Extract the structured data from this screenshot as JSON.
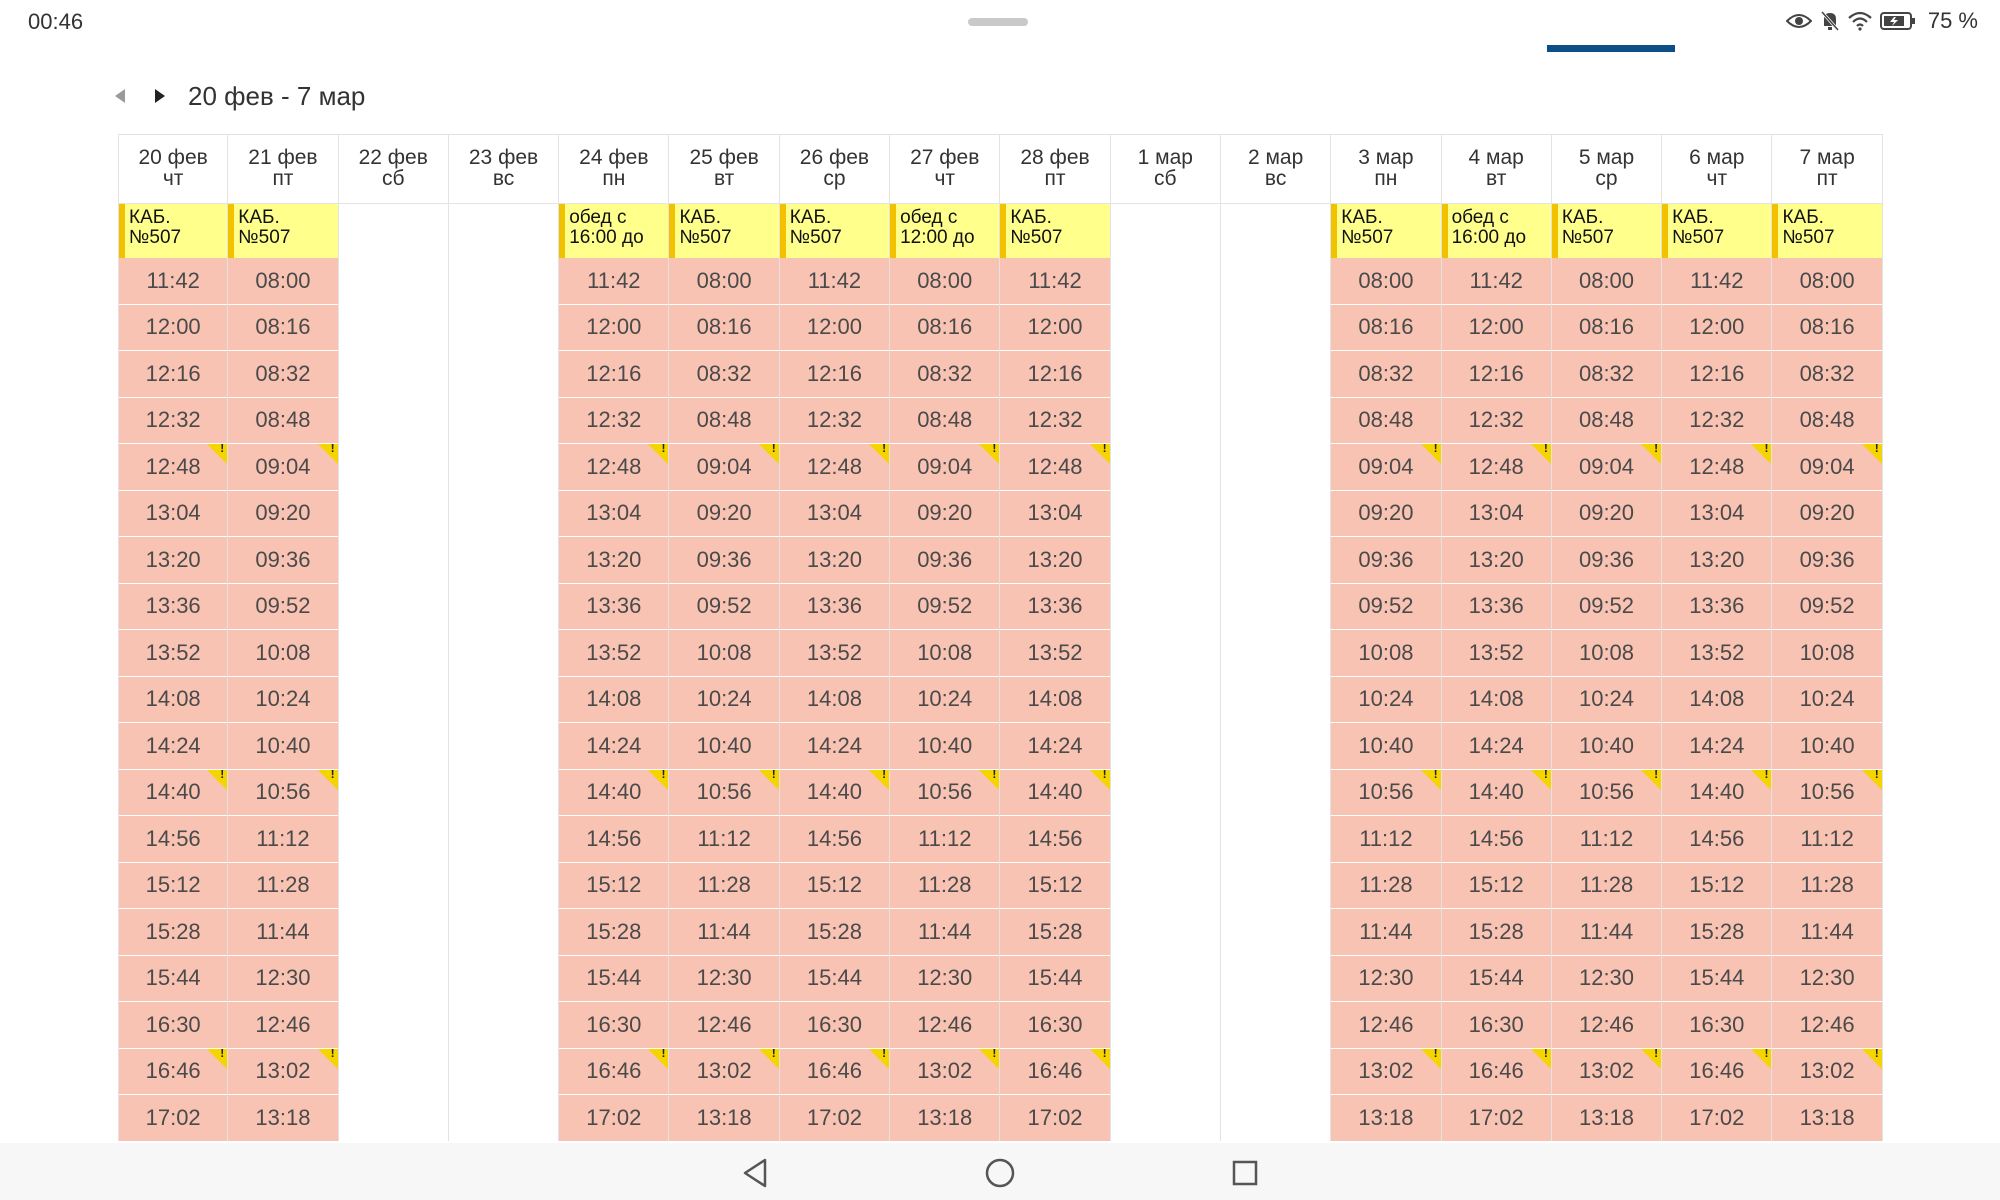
{
  "status_bar": {
    "time": "00:46",
    "battery_text": "75 %",
    "icons": [
      "eye-icon",
      "mute-bell-icon",
      "wifi-icon",
      "battery-icon"
    ]
  },
  "navigation": {
    "prev_icon": "triangle-left-icon",
    "next_icon": "triangle-right-icon",
    "range_label": "20 фев - 7 мар"
  },
  "colors": {
    "slot_bg": "#f8c3b3",
    "note_bg": "#ffff8c",
    "note_accent": "#f2c200",
    "warn_flag": "#f5d400",
    "tab_indicator": "#0b4f86"
  },
  "days": [
    {
      "date": "20 фев",
      "weekday": "чт",
      "note": [
        "КАБ.",
        "№507"
      ],
      "warn": [
        4,
        11,
        17
      ],
      "slots": [
        "11:42",
        "12:00",
        "12:16",
        "12:32",
        "12:48",
        "13:04",
        "13:20",
        "13:36",
        "13:52",
        "14:08",
        "14:24",
        "14:40",
        "14:56",
        "15:12",
        "15:28",
        "15:44",
        "16:30",
        "16:46",
        "17:02"
      ]
    },
    {
      "date": "21 фев",
      "weekday": "пт",
      "note": [
        "КАБ.",
        "№507"
      ],
      "warn": [
        4,
        11,
        17
      ],
      "slots": [
        "08:00",
        "08:16",
        "08:32",
        "08:48",
        "09:04",
        "09:20",
        "09:36",
        "09:52",
        "10:08",
        "10:24",
        "10:40",
        "10:56",
        "11:12",
        "11:28",
        "11:44",
        "12:30",
        "12:46",
        "13:02",
        "13:18"
      ]
    },
    {
      "date": "22 фев",
      "weekday": "сб",
      "note": [],
      "warn": [],
      "slots": []
    },
    {
      "date": "23 фев",
      "weekday": "вс",
      "note": [],
      "warn": [],
      "slots": []
    },
    {
      "date": "24 фев",
      "weekday": "пн",
      "note": [
        "обед с",
        "16:00 до"
      ],
      "warn": [
        4,
        11,
        17
      ],
      "slots": [
        "11:42",
        "12:00",
        "12:16",
        "12:32",
        "12:48",
        "13:04",
        "13:20",
        "13:36",
        "13:52",
        "14:08",
        "14:24",
        "14:40",
        "14:56",
        "15:12",
        "15:28",
        "15:44",
        "16:30",
        "16:46",
        "17:02"
      ]
    },
    {
      "date": "25 фев",
      "weekday": "вт",
      "note": [
        "КАБ.",
        "№507"
      ],
      "warn": [
        4,
        11,
        17
      ],
      "slots": [
        "08:00",
        "08:16",
        "08:32",
        "08:48",
        "09:04",
        "09:20",
        "09:36",
        "09:52",
        "10:08",
        "10:24",
        "10:40",
        "10:56",
        "11:12",
        "11:28",
        "11:44",
        "12:30",
        "12:46",
        "13:02",
        "13:18"
      ]
    },
    {
      "date": "26 фев",
      "weekday": "ср",
      "note": [
        "КАБ.",
        "№507"
      ],
      "warn": [
        4,
        11,
        17
      ],
      "slots": [
        "11:42",
        "12:00",
        "12:16",
        "12:32",
        "12:48",
        "13:04",
        "13:20",
        "13:36",
        "13:52",
        "14:08",
        "14:24",
        "14:40",
        "14:56",
        "15:12",
        "15:28",
        "15:44",
        "16:30",
        "16:46",
        "17:02"
      ]
    },
    {
      "date": "27 фев",
      "weekday": "чт",
      "note": [
        "обед с",
        "12:00 до"
      ],
      "warn": [
        4,
        11,
        17
      ],
      "slots": [
        "08:00",
        "08:16",
        "08:32",
        "08:48",
        "09:04",
        "09:20",
        "09:36",
        "09:52",
        "10:08",
        "10:24",
        "10:40",
        "10:56",
        "11:12",
        "11:28",
        "11:44",
        "12:30",
        "12:46",
        "13:02",
        "13:18"
      ]
    },
    {
      "date": "28 фев",
      "weekday": "пт",
      "note": [
        "КАБ.",
        "№507"
      ],
      "warn": [
        4,
        11,
        17
      ],
      "slots": [
        "11:42",
        "12:00",
        "12:16",
        "12:32",
        "12:48",
        "13:04",
        "13:20",
        "13:36",
        "13:52",
        "14:08",
        "14:24",
        "14:40",
        "14:56",
        "15:12",
        "15:28",
        "15:44",
        "16:30",
        "16:46",
        "17:02"
      ]
    },
    {
      "date": "1 мар",
      "weekday": "сб",
      "note": [],
      "warn": [],
      "slots": []
    },
    {
      "date": "2 мар",
      "weekday": "вс",
      "note": [],
      "warn": [],
      "slots": []
    },
    {
      "date": "3 мар",
      "weekday": "пн",
      "note": [
        "КАБ.",
        "№507"
      ],
      "warn": [
        4,
        11,
        17
      ],
      "slots": [
        "08:00",
        "08:16",
        "08:32",
        "08:48",
        "09:04",
        "09:20",
        "09:36",
        "09:52",
        "10:08",
        "10:24",
        "10:40",
        "10:56",
        "11:12",
        "11:28",
        "11:44",
        "12:30",
        "12:46",
        "13:02",
        "13:18"
      ]
    },
    {
      "date": "4 мар",
      "weekday": "вт",
      "note": [
        "обед с",
        "16:00 до"
      ],
      "warn": [
        4,
        11,
        17
      ],
      "slots": [
        "11:42",
        "12:00",
        "12:16",
        "12:32",
        "12:48",
        "13:04",
        "13:20",
        "13:36",
        "13:52",
        "14:08",
        "14:24",
        "14:40",
        "14:56",
        "15:12",
        "15:28",
        "15:44",
        "16:30",
        "16:46",
        "17:02"
      ]
    },
    {
      "date": "5 мар",
      "weekday": "ср",
      "note": [
        "КАБ.",
        "№507"
      ],
      "warn": [
        4,
        11,
        17
      ],
      "slots": [
        "08:00",
        "08:16",
        "08:32",
        "08:48",
        "09:04",
        "09:20",
        "09:36",
        "09:52",
        "10:08",
        "10:24",
        "10:40",
        "10:56",
        "11:12",
        "11:28",
        "11:44",
        "12:30",
        "12:46",
        "13:02",
        "13:18"
      ]
    },
    {
      "date": "6 мар",
      "weekday": "чт",
      "note": [
        "КАБ.",
        "№507"
      ],
      "warn": [
        4,
        11,
        17
      ],
      "slots": [
        "11:42",
        "12:00",
        "12:16",
        "12:32",
        "12:48",
        "13:04",
        "13:20",
        "13:36",
        "13:52",
        "14:08",
        "14:24",
        "14:40",
        "14:56",
        "15:12",
        "15:28",
        "15:44",
        "16:30",
        "16:46",
        "17:02"
      ]
    },
    {
      "date": "7 мар",
      "weekday": "пт",
      "note": [
        "КАБ.",
        "№507"
      ],
      "warn": [
        4,
        11,
        17
      ],
      "slots": [
        "08:00",
        "08:16",
        "08:32",
        "08:48",
        "09:04",
        "09:20",
        "09:36",
        "09:52",
        "10:08",
        "10:24",
        "10:40",
        "10:56",
        "11:12",
        "11:28",
        "11:44",
        "12:30",
        "12:46",
        "13:02",
        "13:18"
      ]
    }
  ],
  "system_nav": {
    "back_icon": "back-triangle-icon",
    "home_icon": "home-circle-icon",
    "recents_icon": "recents-square-icon"
  }
}
